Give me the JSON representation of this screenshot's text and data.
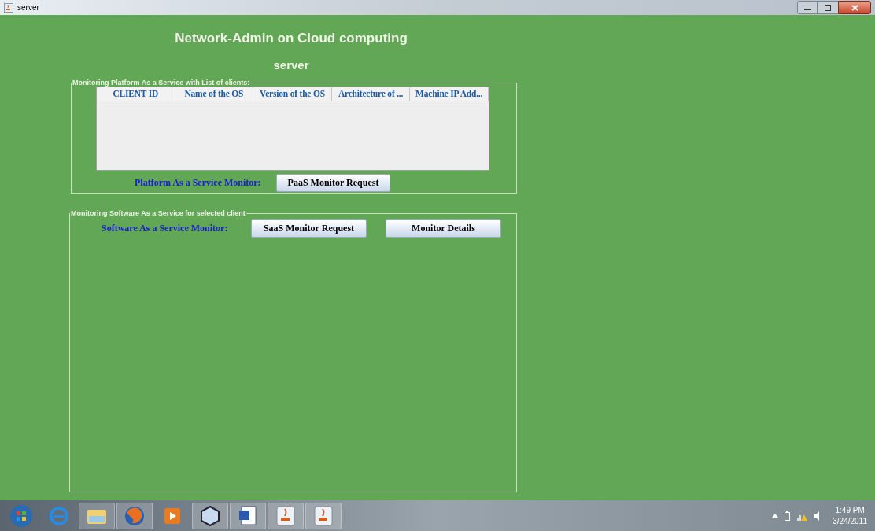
{
  "window": {
    "title": "server"
  },
  "heading": {
    "title": "Network-Admin on Cloud computing",
    "subtitle": "server"
  },
  "platform_panel": {
    "legend": "Monitoring Platform As a Service with List of clients:",
    "table": {
      "columns": [
        "CLIENT ID",
        "Name of the OS",
        "Version of the OS",
        "Architecture of ...",
        "Machine IP Add..."
      ]
    },
    "monitor_label": "Platform As a Service Monitor:",
    "buttons": [
      "PaaS Monitor Request"
    ]
  },
  "software_panel": {
    "legend": "Monitoring Software As a Service for selected client",
    "monitor_label": "Software As a Service Monitor:",
    "buttons": [
      "SaaS Monitor Request",
      "Monitor Details"
    ]
  },
  "taskbar": {
    "clock": {
      "time": "1:49 PM",
      "date": "3/24/2011"
    }
  }
}
